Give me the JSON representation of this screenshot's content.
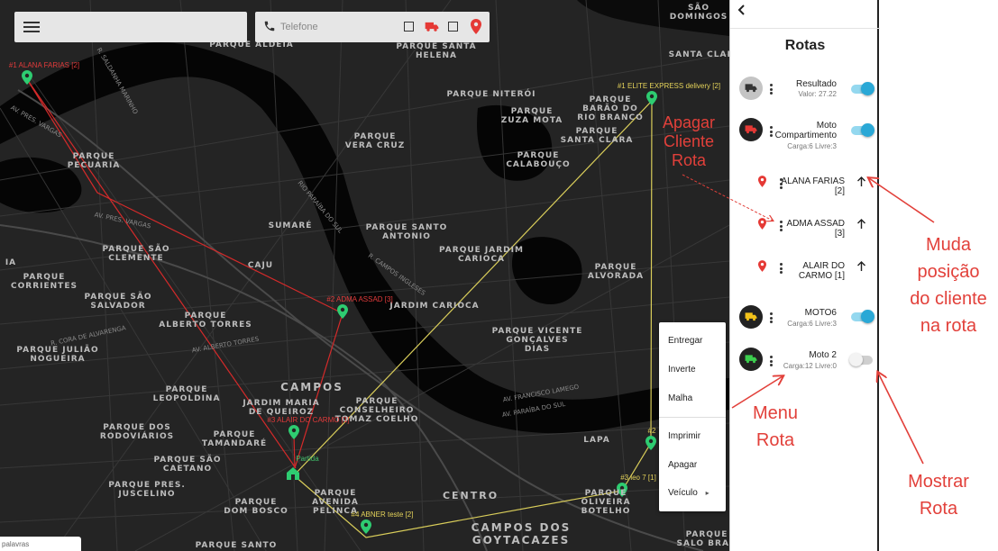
{
  "top_bar": {
    "phone_placeholder": "Telefone"
  },
  "map_labels": [
    {
      "text": "PARQUE ALDEIA"
    },
    {
      "text": "PARQUE SANTA\nHELENA"
    },
    {
      "text": "PARQUE NITERÓI"
    },
    {
      "text": "PARQUE\nZUZA MOTA"
    },
    {
      "text": "PARQUE\nBARÃO DO\nRIO BRANCO"
    },
    {
      "text": "PARQUE\nSANTA CLARA"
    },
    {
      "text": "PARQUE\nVERA CRUZ"
    },
    {
      "text": "PARQUE\nCALABOUÇO"
    },
    {
      "text": "PARQUE\nPECUARIA"
    },
    {
      "text": "SUMARÉ"
    },
    {
      "text": "PARQUE SANTO\nANTONIO"
    },
    {
      "text": "PARQUE JARDIM\nCARIOCA"
    },
    {
      "text": "PARQUE SÃO\nCLEMENTE"
    },
    {
      "text": "CAJU"
    },
    {
      "text": "PARQUE\nCORRIENTES"
    },
    {
      "text": "PARQUE\nALVORADA"
    },
    {
      "text": "PARQUE SÃO\nSALVADOR"
    },
    {
      "text": "JARDIM CARIOCA"
    },
    {
      "text": "PARQUE\nALBERTO TORRES"
    },
    {
      "text": "PARQUE VICENTE\nGONÇALVES\nDIAS"
    },
    {
      "text": "PARQUE JULIÃO\nNOGUEIRA"
    },
    {
      "text": "PARQUE\nLEOPOLDINA"
    },
    {
      "text": "JARDIM MARIA\nDE QUEIROZ"
    },
    {
      "text": "PARQUE\nCONSELHEIRO\nTOMAZ COELHO"
    },
    {
      "text": "PARQUE DOS\nRODOVIÁRIOS"
    },
    {
      "text": "PARQUE\nTAMANDARÉ"
    },
    {
      "text": "PARQUE SÃO\nCAETANO"
    },
    {
      "text": "LAPA"
    },
    {
      "text": "PARQUE PRES.\nJUSCELINO"
    },
    {
      "text": "PARQUE\nAVENIDA\nPELINCA"
    },
    {
      "text": "CENTRO"
    },
    {
      "text": "PARQUE\nOLIVEIRA\nBOTELHO"
    },
    {
      "text": "PARQUE\nDOM BOSCO"
    },
    {
      "text": "PARQUE SANTO"
    },
    {
      "text": "SÃO\nDOMINGOS"
    },
    {
      "text": "SANTA CLAR"
    },
    {
      "text": "PARQUE\nSALO BRAN"
    },
    {
      "text": "IA"
    }
  ],
  "map_big_labels": {
    "campos": "Campos",
    "campos_goytacazes": "Campos dos\nGoytacazes"
  },
  "street_labels": [
    {
      "text": "Av. Pres. Vargas"
    },
    {
      "text": "Av. Pres. Vargas"
    },
    {
      "text": "R. Cora de Alvarenga"
    },
    {
      "text": "Av. Alberto Torres"
    },
    {
      "text": "R. Campos Ingleses"
    },
    {
      "text": "Av. Francisco Lamego"
    },
    {
      "text": "Av. Paraíba do Sul"
    },
    {
      "text": "Rio Paraíba do Sul"
    },
    {
      "text": "R. Saldanha Marinho"
    }
  ],
  "markers": [
    {
      "label": "#1 ALANA FARIAS [2]",
      "color": "red"
    },
    {
      "label": "#2 ADMA ASSAD [3]",
      "color": "red"
    },
    {
      "label": "#3 ALAIR DO CARMO [1]",
      "color": "red"
    },
    {
      "label": "#1 ELITE EXPRESS delivery [2]",
      "color": "yellow"
    },
    {
      "label": "#4 ABNER teste [2]",
      "color": "yellow"
    },
    {
      "label": "#3 leo 7 [1]",
      "color": "yellow"
    },
    {
      "label": "#2",
      "color": "yellow"
    },
    {
      "label": "Partida",
      "color": "green"
    }
  ],
  "context_menu": {
    "items": [
      "Entregar",
      "Inverte",
      "Malha",
      "Imprimir",
      "Apagar",
      "Veículo"
    ],
    "submenu_arrow": "▸"
  },
  "footer_tab": "palavras",
  "panel": {
    "title": "Rotas",
    "vehicles": [
      {
        "name": "Resultado",
        "sub": "Valor: 27.22",
        "avatar_color": "#c4c4c4",
        "icon_color": "#333333",
        "toggle": true
      },
      {
        "name": "Moto\nCompartimento",
        "sub": "Carga:6 Livre:3",
        "avatar_color": "#222222",
        "icon_color": "#e53935",
        "toggle": true
      },
      {
        "name": "MOTO6",
        "sub": "Carga:6 Livre:3",
        "avatar_color": "#222222",
        "icon_color": "#f2c21b",
        "toggle": true
      },
      {
        "name": "Moto 2",
        "sub": "Carga:12 Livre:0",
        "avatar_color": "#222222",
        "icon_color": "#3ccf4e",
        "toggle": false
      }
    ],
    "clients": [
      {
        "name": "ALANA FARIAS\n[2]"
      },
      {
        "name": "ADMA ASSAD\n[3]"
      },
      {
        "name": "ALAIR DO\nCARMO [1]"
      }
    ]
  },
  "annotations": {
    "apagar": "Apagar\nCliente\nRota",
    "muda": "Muda\nposição\ndo cliente\nna rota",
    "menu": "Menu\nRota",
    "mostrar": "Mostrar\nRota"
  },
  "colors": {
    "map_bg": "#242424",
    "road": "#3a3a3a",
    "water": "#050505",
    "route_red": "#d42a2a",
    "route_yellow": "#d9cd5a",
    "pin_green": "#2ecc71",
    "toggle_blue": "#2aa8d6",
    "annotation": "#e2403a"
  },
  "icons": {
    "menu": "hamburger-icon",
    "phone": "phone-icon",
    "truck": "truck-icon",
    "pin": "map-pin-icon",
    "back": "chevron-left-icon",
    "more": "kebab-icon",
    "up": "arrow-up-icon"
  }
}
